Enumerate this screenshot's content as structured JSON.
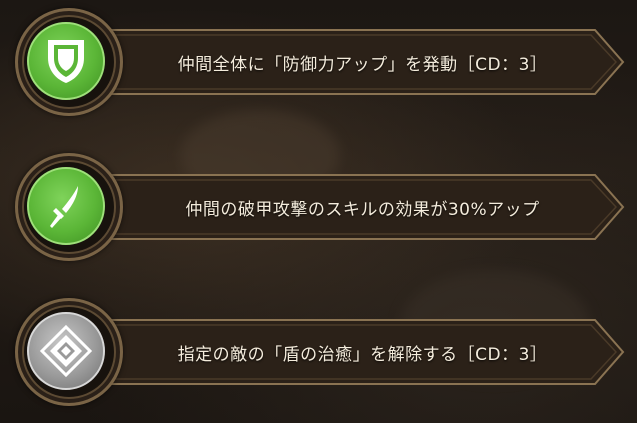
{
  "skills": [
    {
      "icon": "shield-icon",
      "color": "#5bb637",
      "text": "仲間全体に「防御力アップ」を発動［CD：3］"
    },
    {
      "icon": "blade-icon",
      "color": "#5bb637",
      "text": "仲間の破甲攻撃のスキルの効果が30%アップ"
    },
    {
      "icon": "diamond-icon",
      "color": "#9a9a9a",
      "text": "指定の敵の「盾の治癒」を解除する［CD：3］"
    }
  ]
}
